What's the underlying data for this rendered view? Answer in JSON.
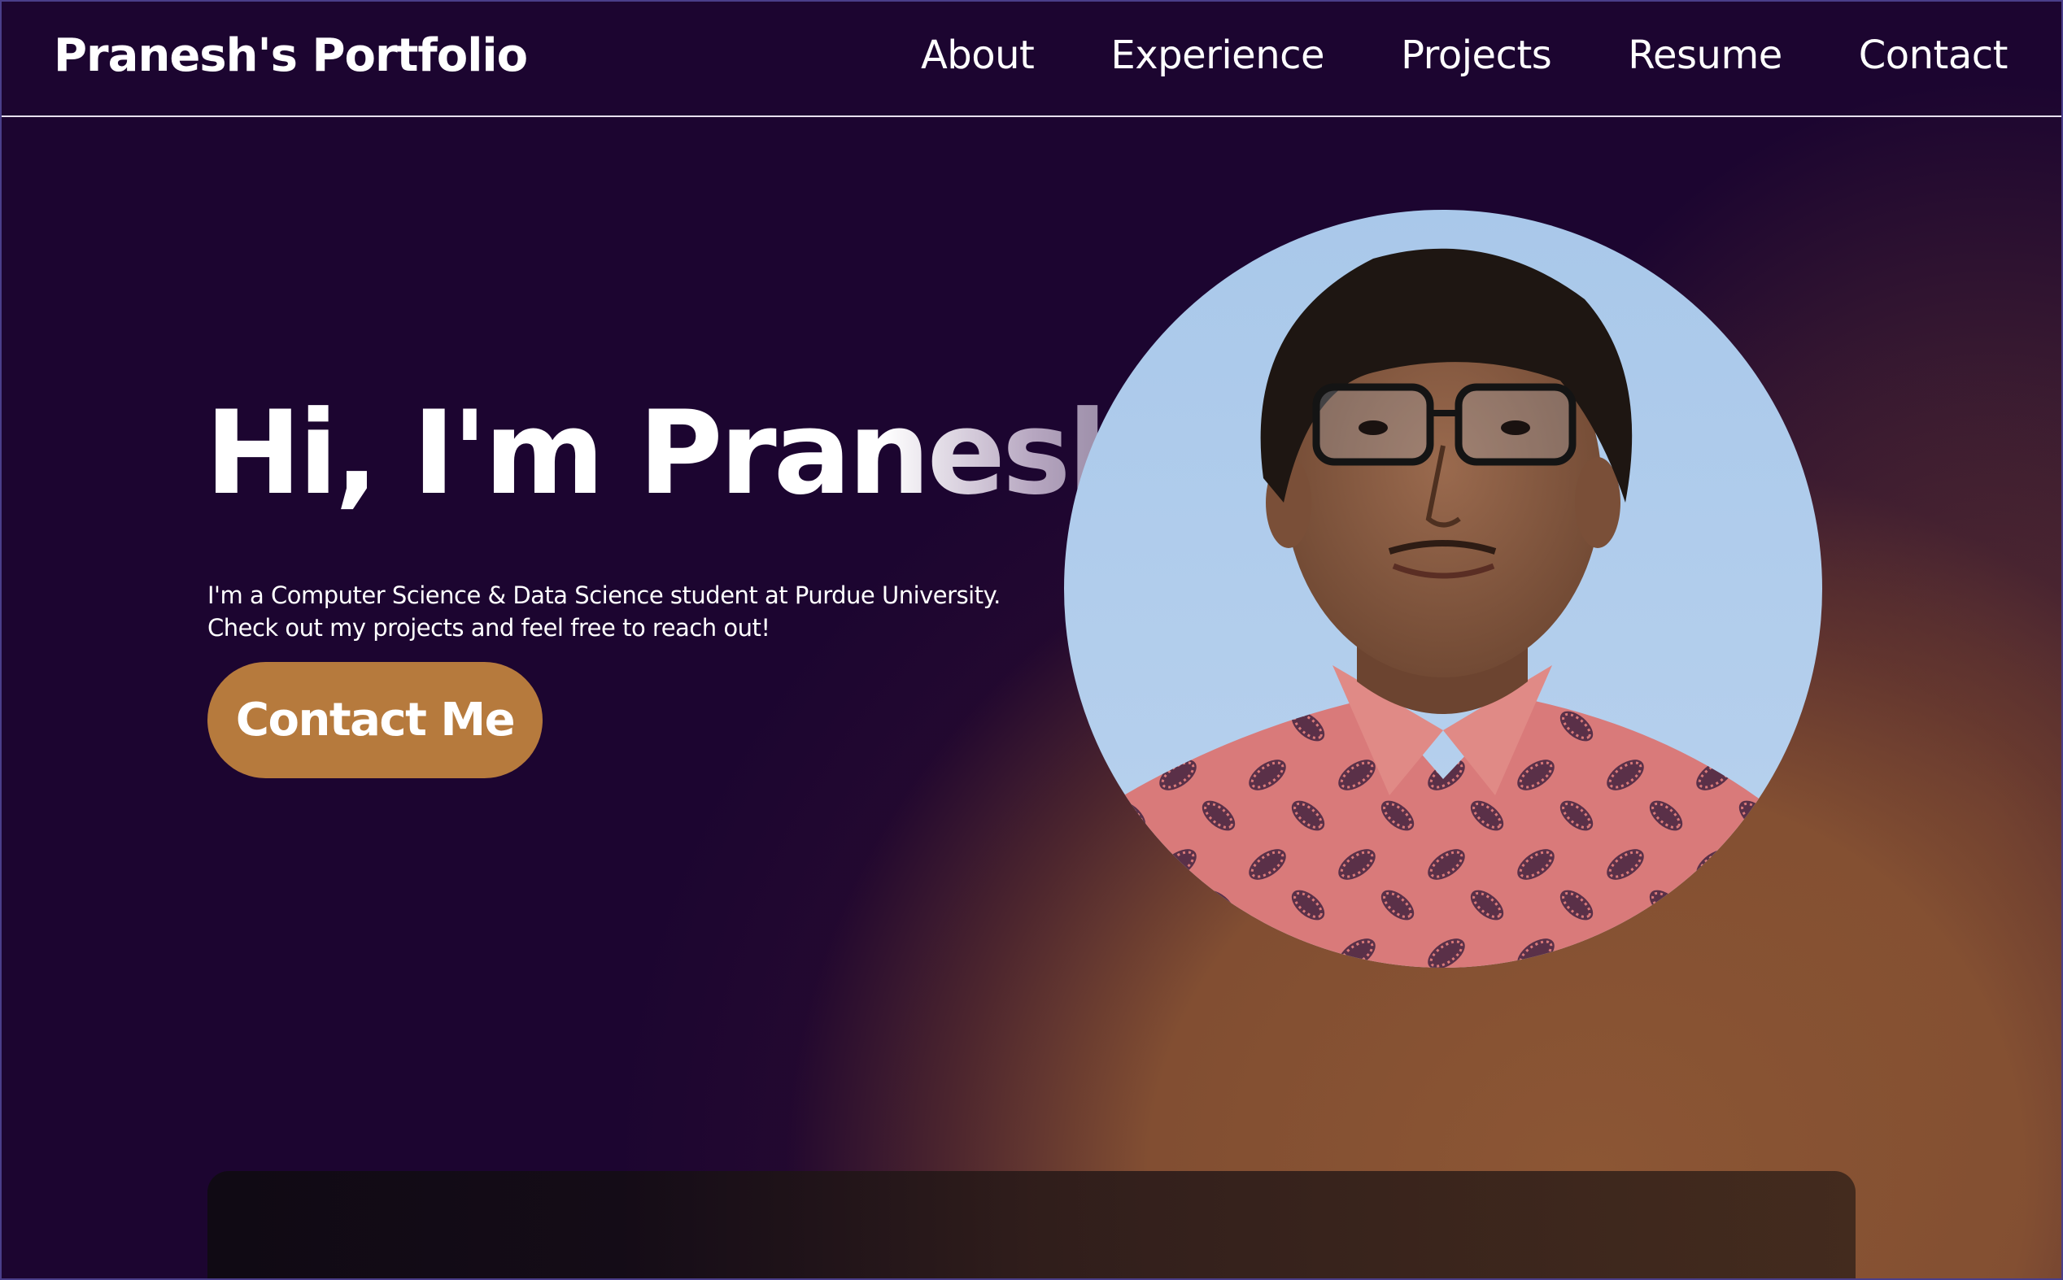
{
  "nav": {
    "brand": "Pranesh's Portfolio",
    "links": [
      "About",
      "Experience",
      "Projects",
      "Resume",
      "Contact"
    ]
  },
  "hero": {
    "title": "Hi, I'm Pranesh",
    "description_line1": "I'm a Computer Science & Data Science student at Purdue University.",
    "description_line2": "Check out my projects and feel free to reach out!",
    "cta_label": "Contact Me"
  },
  "colors": {
    "background": "#1c0530",
    "accent_button": "#b67a3d",
    "glow": "#8c5634",
    "text": "#ffffff"
  },
  "icons": {
    "avatar": "profile-photo"
  }
}
